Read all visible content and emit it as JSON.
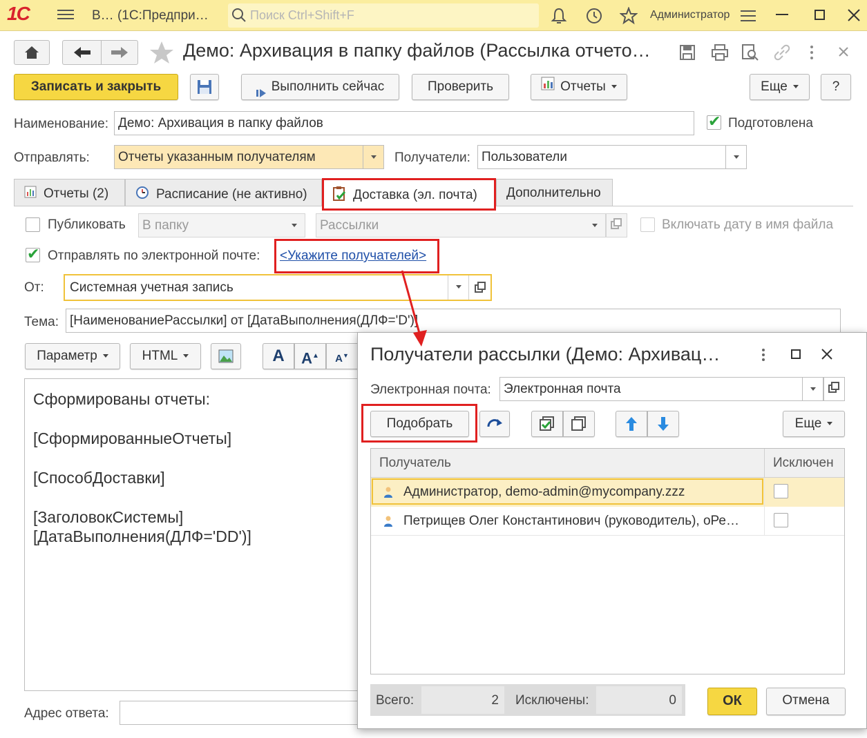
{
  "app": {
    "logo": "1С",
    "title": "В…  (1С:Предпри…",
    "search_placeholder": "Поиск Ctrl+Shift+F",
    "user": "Администратор"
  },
  "window": {
    "title": "Демо: Архивация в папку файлов (Рассылка отчето…"
  },
  "toolbar": {
    "save_close": "Записать и закрыть",
    "run_now": "Выполнить сейчас",
    "check": "Проверить",
    "reports": "Отчеты",
    "more": "Еще",
    "help": "?"
  },
  "form": {
    "name_label": "Наименование:",
    "name_value": "Демо: Архивация в папку файлов",
    "prepared_label": "Подготовлена",
    "send_label": "Отправлять:",
    "send_value": "Отчеты указанным получателям",
    "recipients_label": "Получатели:",
    "recipients_value": "Пользователи"
  },
  "tabs": [
    {
      "label": "Отчеты (2)"
    },
    {
      "label": "Расписание (не активно)"
    },
    {
      "label": "Доставка (эл. почта)"
    },
    {
      "label": "Дополнительно"
    }
  ],
  "delivery": {
    "publish_label": "Публиковать",
    "publish_to": "В папку",
    "publish_target": "Рассылки",
    "include_date": "Включать дату в имя файла",
    "email_label": "Отправлять по электронной почте:",
    "email_link": "<Укажите получателей>",
    "from_label": "От:",
    "from_value": "Системная учетная запись",
    "subject_label": "Тема:",
    "subject_value": "[НаименованиеРассылки] от [ДатаВыполнения(ДЛФ='D')]",
    "param_btn": "Параметр",
    "html_btn": "HTML",
    "body_lines": [
      "Сформированы отчеты:",
      "[СформированныеОтчеты]",
      "[СпособДоставки]",
      "[ЗаголовокСистемы]",
      "[ДатаВыполнения(ДЛФ='DD')]"
    ],
    "reply_label": "Адрес ответа:"
  },
  "dialog": {
    "title": "Получатели рассылки (Демо: Архивац…",
    "email_label": "Электронная почта:",
    "email_value": "Электронная почта",
    "pick_btn": "Подобрать",
    "more_btn": "Еще",
    "col_recipient": "Получатель",
    "col_excluded": "Исключен",
    "rows": [
      {
        "name": "Администратор, demo-admin@mycompany.zzz",
        "excluded": false
      },
      {
        "name": "Петрищев Олег Константинович (руководитель), оРе…",
        "excluded": false
      }
    ],
    "total_label": "Всего:",
    "total_value": "2",
    "excluded_label": "Исключены:",
    "excluded_value": "0",
    "ok_btn": "ОК",
    "cancel_btn": "Отмена"
  },
  "colors": {
    "appbar": "#fbed9e",
    "primary_button": "#f6d742",
    "highlight": "#e02020",
    "link": "#1f4fa8"
  }
}
